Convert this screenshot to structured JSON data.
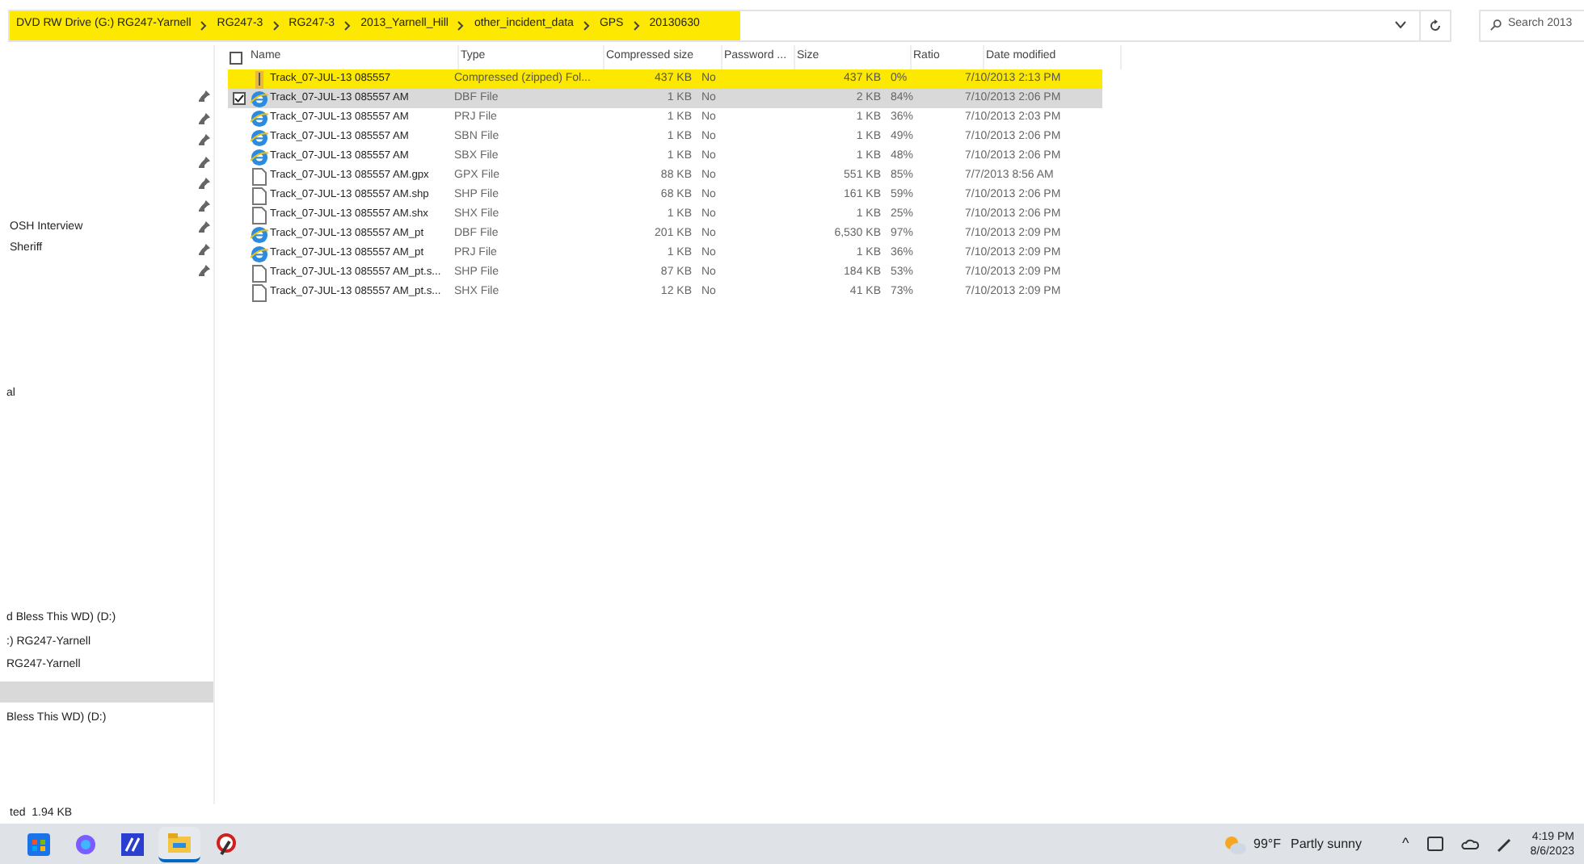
{
  "address_bar": {
    "highlighted": true,
    "crumbs": [
      "DVD RW Drive (G:) RG247-Yarnell",
      "RG247-3",
      "RG247-3",
      "2013_Yarnell_Hill",
      "other_incident_data",
      "GPS",
      "20130630"
    ]
  },
  "search": {
    "placeholder": "Search 2013"
  },
  "sidebar": {
    "quick_access": [
      {
        "pinned": true
      },
      {
        "pinned": true
      },
      {
        "pinned": true
      },
      {
        "pinned": true
      },
      {
        "pinned": true
      },
      {
        "pinned": true
      },
      {
        "label": "OSH Interview",
        "pinned": true
      },
      {
        "label": "Sheriff",
        "pinned": true
      },
      {
        "pinned": true
      }
    ],
    "middle": [
      "al"
    ],
    "drives": [
      {
        "label": "d Bless This WD) (D:)",
        "selected": false
      },
      {
        "label": ":) RG247-Yarnell",
        "selected": false
      },
      {
        "label": "RG247-Yarnell",
        "selected": false
      },
      {
        "selected": true
      },
      {
        "label": "Bless This WD) (D:)",
        "selected": false
      }
    ]
  },
  "table": {
    "select_all": {
      "checked": false
    },
    "columns": [
      "Name",
      "Type",
      "Compressed size",
      "Password ...",
      "Size",
      "Ratio",
      "Date modified"
    ],
    "rows": [
      {
        "kind": "zip",
        "highlighted": true,
        "selected": false,
        "name": "Track_07-JUL-13 085557",
        "type": "Compressed (zipped) Fol...",
        "compressed": "437 KB",
        "password": "No",
        "size": "437 KB",
        "ratio": "0%",
        "date": "7/10/2013 2:13 PM"
      },
      {
        "kind": "web",
        "highlighted": false,
        "selected": true,
        "name": "Track_07-JUL-13 085557 AM",
        "type": "DBF File",
        "compressed": "1 KB",
        "password": "No",
        "size": "2 KB",
        "ratio": "84%",
        "date": "7/10/2013 2:06 PM"
      },
      {
        "kind": "web",
        "highlighted": false,
        "selected": false,
        "name": "Track_07-JUL-13 085557 AM",
        "type": "PRJ File",
        "compressed": "1 KB",
        "password": "No",
        "size": "1 KB",
        "ratio": "36%",
        "date": "7/10/2013 2:03 PM"
      },
      {
        "kind": "web",
        "highlighted": false,
        "selected": false,
        "name": "Track_07-JUL-13 085557 AM",
        "type": "SBN File",
        "compressed": "1 KB",
        "password": "No",
        "size": "1 KB",
        "ratio": "49%",
        "date": "7/10/2013 2:06 PM"
      },
      {
        "kind": "web",
        "highlighted": false,
        "selected": false,
        "name": "Track_07-JUL-13 085557 AM",
        "type": "SBX File",
        "compressed": "1 KB",
        "password": "No",
        "size": "1 KB",
        "ratio": "48%",
        "date": "7/10/2013 2:06 PM"
      },
      {
        "kind": "doc",
        "highlighted": false,
        "selected": false,
        "name": "Track_07-JUL-13 085557 AM.gpx",
        "type": "GPX File",
        "compressed": "88 KB",
        "password": "No",
        "size": "551 KB",
        "ratio": "85%",
        "date": "7/7/2013 8:56 AM"
      },
      {
        "kind": "doc",
        "highlighted": false,
        "selected": false,
        "name": "Track_07-JUL-13 085557 AM.shp",
        "type": "SHP File",
        "compressed": "68 KB",
        "password": "No",
        "size": "161 KB",
        "ratio": "59%",
        "date": "7/10/2013 2:06 PM"
      },
      {
        "kind": "doc",
        "highlighted": false,
        "selected": false,
        "name": "Track_07-JUL-13 085557 AM.shx",
        "type": "SHX File",
        "compressed": "1 KB",
        "password": "No",
        "size": "1 KB",
        "ratio": "25%",
        "date": "7/10/2013 2:06 PM"
      },
      {
        "kind": "web",
        "highlighted": false,
        "selected": false,
        "name": "Track_07-JUL-13 085557 AM_pt",
        "type": "DBF File",
        "compressed": "201 KB",
        "password": "No",
        "size": "6,530 KB",
        "ratio": "97%",
        "date": "7/10/2013 2:09 PM"
      },
      {
        "kind": "web",
        "highlighted": false,
        "selected": false,
        "name": "Track_07-JUL-13 085557 AM_pt",
        "type": "PRJ File",
        "compressed": "1 KB",
        "password": "No",
        "size": "1 KB",
        "ratio": "36%",
        "date": "7/10/2013 2:09 PM"
      },
      {
        "kind": "doc",
        "highlighted": false,
        "selected": false,
        "name": "Track_07-JUL-13 085557 AM_pt.s...",
        "type": "SHP File",
        "compressed": "87 KB",
        "password": "No",
        "size": "184 KB",
        "ratio": "53%",
        "date": "7/10/2013 2:09 PM"
      },
      {
        "kind": "doc",
        "highlighted": false,
        "selected": false,
        "name": "Track_07-JUL-13 085557 AM_pt.s...",
        "type": "SHX File",
        "compressed": "12 KB",
        "password": "No",
        "size": "41 KB",
        "ratio": "73%",
        "date": "7/10/2013 2:09 PM"
      }
    ]
  },
  "status_bar": {
    "text": "ted  1.94 KB"
  },
  "taskbar": {
    "apps": [
      {
        "kind": "store",
        "active": false
      },
      {
        "kind": "copilot",
        "active": false
      },
      {
        "kind": "editor",
        "active": false
      },
      {
        "kind": "folder",
        "active": true
      },
      {
        "kind": "tool",
        "active": false
      }
    ],
    "weather": {
      "temp": "99°F",
      "condition": "Partly sunny"
    },
    "tray_caret": "^",
    "time": "4:19 PM",
    "date": "8/6/2023"
  }
}
